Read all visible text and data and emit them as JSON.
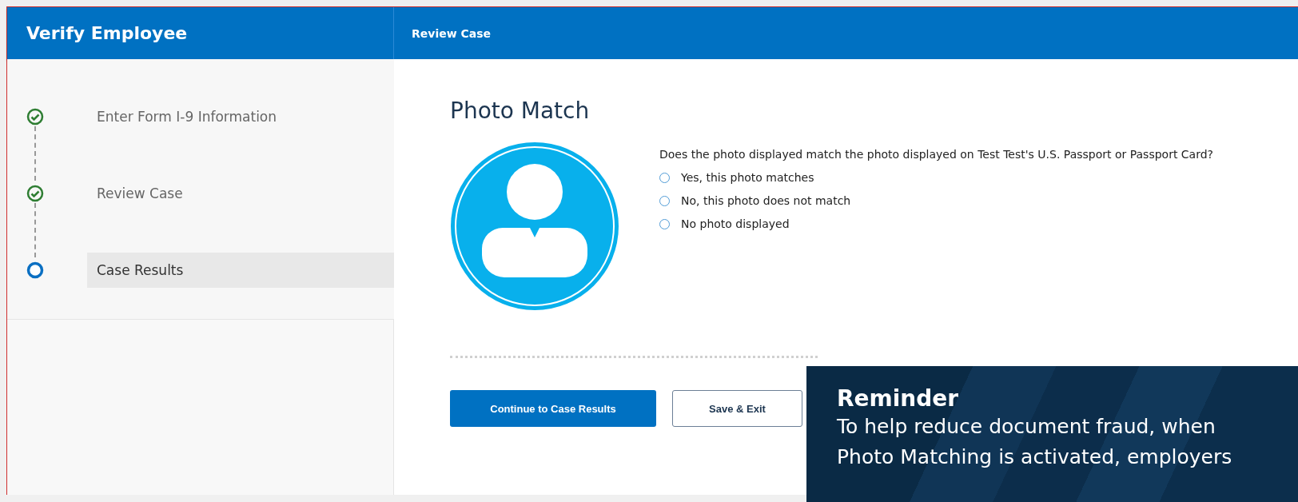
{
  "header": {
    "title": "Verify Employee",
    "section": "Review Case"
  },
  "steps": [
    {
      "label": "Enter Form I-9 Information",
      "kind": "done",
      "selected": false
    },
    {
      "label": "Review Case",
      "kind": "done",
      "selected": false
    },
    {
      "label": "Case Results",
      "kind": "current",
      "selected": true
    }
  ],
  "main": {
    "title": "Photo Match",
    "avatar": {
      "kind": "placeholder"
    },
    "question": "Does the photo displayed match the photo displayed on Test Test's U.S. Passport or Passport Card?",
    "options": [
      {
        "label": "Yes, this photo matches",
        "selected": false
      },
      {
        "label": "No, this photo does not match",
        "selected": false
      },
      {
        "label": "No photo displayed",
        "selected": false
      }
    ],
    "buttons": [
      {
        "label": "Continue to Case Results",
        "kind": "primary"
      },
      {
        "label": "Save & Exit",
        "kind": "secondary"
      }
    ]
  },
  "reminder": {
    "title": "Reminder",
    "lines": [
      "To help reduce document fraud, when",
      "Photo Matching is activated, employers"
    ]
  }
}
